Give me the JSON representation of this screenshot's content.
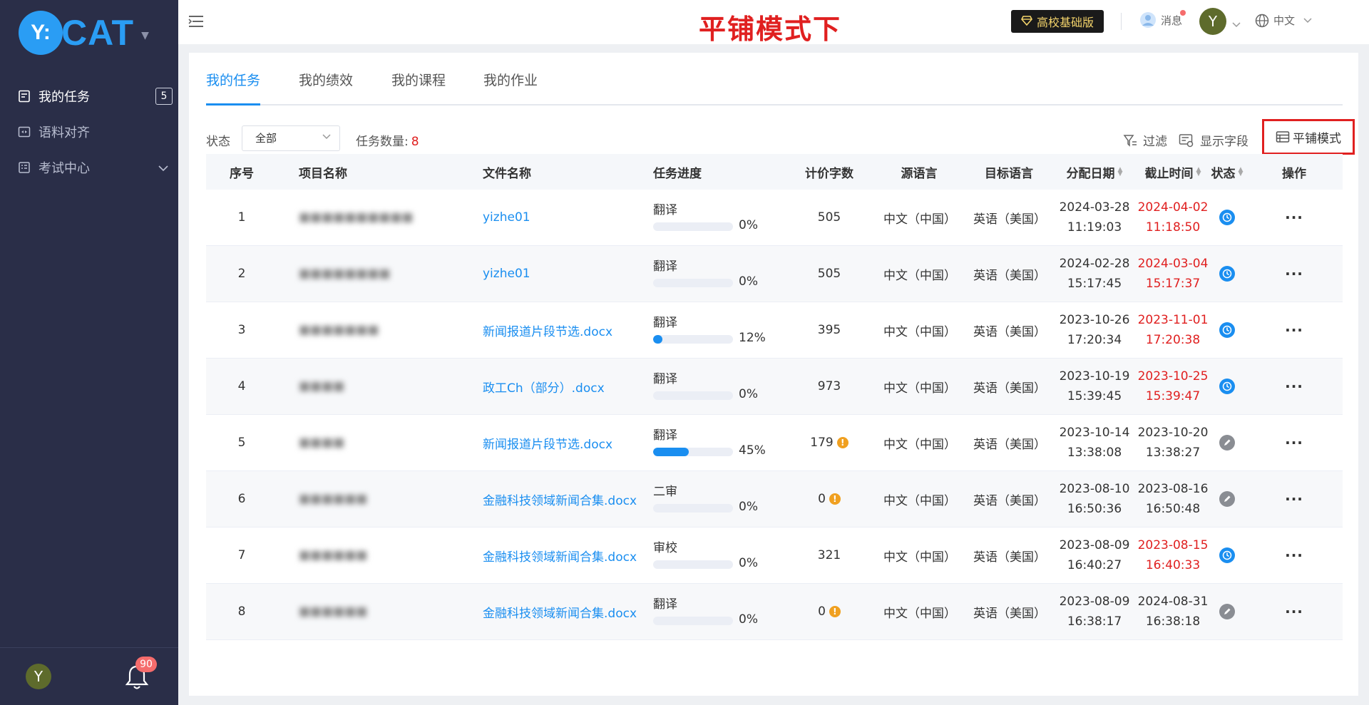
{
  "app": {
    "brand_badge": "Y:",
    "brand_text": "CAT",
    "accent_color": "#1a8ef0",
    "sidebar_bg": "#2a2e48"
  },
  "sidebar": {
    "items": [
      {
        "label": "我的任务",
        "badge": "5",
        "icon": "task-doc-icon"
      },
      {
        "label": "语料对齐",
        "icon": "align-icon"
      },
      {
        "label": "考试中心",
        "icon": "exam-icon"
      }
    ],
    "avatar_letter": "Y",
    "bell_badge": "90"
  },
  "header": {
    "banner": "平铺模式下",
    "edition": "高校基础版",
    "messages": "消息",
    "avatar_letter": "Y",
    "language": "中文"
  },
  "tabs": [
    {
      "label": "我的任务"
    },
    {
      "label": "我的绩效"
    },
    {
      "label": "我的课程"
    },
    {
      "label": "我的作业"
    }
  ],
  "filters": {
    "status_label": "状态",
    "status_value": "全部",
    "count_label": "任务数量:",
    "count_value": "8",
    "filter_btn": "过滤",
    "fields_btn": "显示字段",
    "tile_btn": "平铺模式"
  },
  "table": {
    "columns": [
      "序号",
      "项目名称",
      "文件名称",
      "任务进度",
      "计价字数",
      "源语言",
      "目标语言",
      "分配日期",
      "截止时间",
      "状态",
      "操作"
    ],
    "rows": [
      {
        "index": "1",
        "project": "■■■■■■■■■■",
        "file": "yizhe01",
        "stage": "翻译",
        "progress": 0,
        "pct": "0%",
        "words": "505",
        "warn": false,
        "src": "中文（中国）",
        "tgt": "英语（美国）",
        "assign_date": "2024-03-28",
        "assign_time": "11:19:03",
        "due_date": "2024-04-02",
        "due_time": "11:18:50",
        "due_red": true,
        "status": "clock"
      },
      {
        "index": "2",
        "project": "■■■■■■■■",
        "file": "yizhe01",
        "stage": "翻译",
        "progress": 0,
        "pct": "0%",
        "words": "505",
        "warn": false,
        "src": "中文（中国）",
        "tgt": "英语（美国）",
        "assign_date": "2024-02-28",
        "assign_time": "15:17:45",
        "due_date": "2024-03-04",
        "due_time": "15:17:37",
        "due_red": true,
        "status": "clock"
      },
      {
        "index": "3",
        "project": "■■■■■■■",
        "file": "新闻报道片段节选.docx",
        "stage": "翻译",
        "progress": 12,
        "pct": "12%",
        "words": "395",
        "warn": false,
        "src": "中文（中国）",
        "tgt": "英语（美国）",
        "assign_date": "2023-10-26",
        "assign_time": "17:20:34",
        "due_date": "2023-11-01",
        "due_time": "17:20:38",
        "due_red": true,
        "status": "clock"
      },
      {
        "index": "4",
        "project": "■■■■",
        "file": "政工Ch（部分）.docx",
        "stage": "翻译",
        "progress": 0,
        "pct": "0%",
        "words": "973",
        "warn": false,
        "src": "中文（中国）",
        "tgt": "英语（美国）",
        "assign_date": "2023-10-19",
        "assign_time": "15:39:45",
        "due_date": "2023-10-25",
        "due_time": "15:39:47",
        "due_red": true,
        "status": "clock"
      },
      {
        "index": "5",
        "project": "■■■■",
        "file": "新闻报道片段节选.docx",
        "stage": "翻译",
        "progress": 45,
        "pct": "45%",
        "words": "179",
        "warn": true,
        "src": "中文（中国）",
        "tgt": "英语（美国）",
        "assign_date": "2023-10-14",
        "assign_time": "13:38:08",
        "due_date": "2023-10-20",
        "due_time": "13:38:27",
        "due_red": false,
        "status": "edit"
      },
      {
        "index": "6",
        "project": "■■■■■■",
        "file": "金融科技领域新闻合集.docx",
        "stage": "二审",
        "progress": 0,
        "pct": "0%",
        "words": "0",
        "warn": true,
        "src": "中文（中国）",
        "tgt": "英语（美国）",
        "assign_date": "2023-08-10",
        "assign_time": "16:50:36",
        "due_date": "2023-08-16",
        "due_time": "16:50:48",
        "due_red": false,
        "status": "edit"
      },
      {
        "index": "7",
        "project": "■■■■■■",
        "file": "金融科技领域新闻合集.docx",
        "stage": "审校",
        "progress": 0,
        "pct": "0%",
        "words": "321",
        "warn": false,
        "src": "中文（中国）",
        "tgt": "英语（美国）",
        "assign_date": "2023-08-09",
        "assign_time": "16:40:27",
        "due_date": "2023-08-15",
        "due_time": "16:40:33",
        "due_red": true,
        "status": "clock"
      },
      {
        "index": "8",
        "project": "■■■■■■",
        "file": "金融科技领域新闻合集.docx",
        "stage": "翻译",
        "progress": 0,
        "pct": "0%",
        "words": "0",
        "warn": true,
        "src": "中文（中国）",
        "tgt": "英语（美国）",
        "assign_date": "2023-08-09",
        "assign_time": "16:38:17",
        "due_date": "2024-08-31",
        "due_time": "16:38:18",
        "due_red": false,
        "status": "edit"
      }
    ],
    "more_label": "···"
  }
}
